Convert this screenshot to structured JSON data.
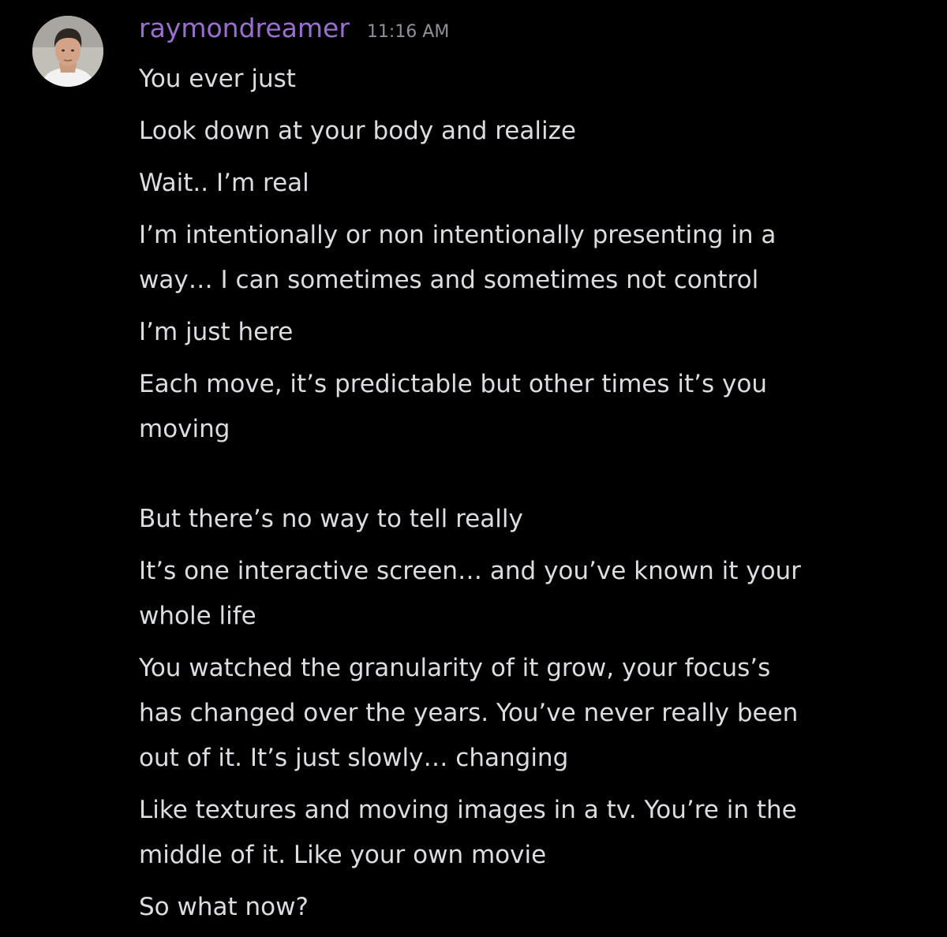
{
  "message": {
    "username": "raymondreamer",
    "timestamp": "11:16 AM",
    "lines": [
      [
        "You ever just"
      ],
      [
        "Look down at your body and realize"
      ],
      [
        "Wait.. I’m real"
      ],
      [
        "I’m intentionally or non intentionally presenting in a",
        "way… I can sometimes and sometimes not control"
      ],
      [
        "I’m just here"
      ],
      [
        "Each move, it’s predictable but other times it’s you",
        "moving"
      ],
      [],
      [
        "But there’s no way to tell really"
      ],
      [
        "It’s one interactive screen… and you’ve known it your",
        "whole life"
      ],
      [
        "You watched the granularity of it grow, your focus’s",
        "has changed over the years. You’ve never really been",
        "out of it. It’s just slowly… changing"
      ],
      [
        "Like textures and moving images in a tv. You’re in the",
        "middle of it. Like your own movie"
      ],
      [
        "So what now?"
      ]
    ]
  },
  "colors": {
    "background": "#000000",
    "username": "#9b6fd0",
    "text": "#dcdde1",
    "timestamp": "#8e9097"
  },
  "icons": {
    "avatar": "user-avatar-photo"
  }
}
